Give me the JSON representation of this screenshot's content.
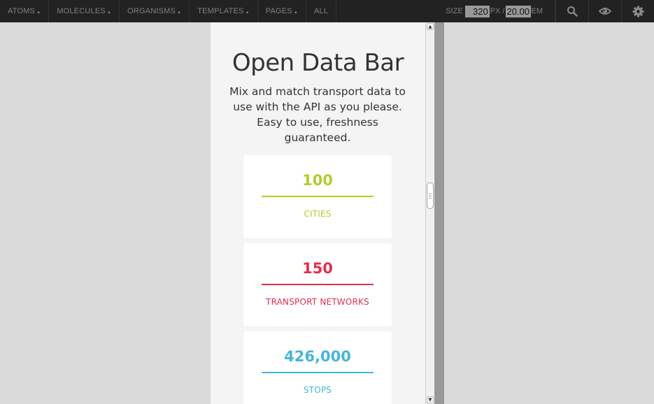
{
  "nav": {
    "items": [
      {
        "label": "ATOMS",
        "caret": "▲",
        "name": "nav-atoms"
      },
      {
        "label": "MOLECULES",
        "caret": "▲",
        "name": "nav-molecules"
      },
      {
        "label": "ORGANISMS",
        "caret": "▲",
        "name": "nav-organisms"
      },
      {
        "label": "TEMPLATES",
        "caret": "▲",
        "name": "nav-templates"
      },
      {
        "label": "PAGES",
        "caret": "▲",
        "name": "nav-pages"
      },
      {
        "label": "ALL",
        "caret": "",
        "name": "nav-all"
      }
    ],
    "size": {
      "label": "SIZE",
      "px_value": "320",
      "px_unit": "PX /",
      "em_value": "20.00",
      "em_unit": "EM"
    },
    "icons": [
      "search-icon",
      "eye-icon",
      "gear-icon"
    ]
  },
  "hero": {
    "title": "Open Data Bar",
    "description": "Mix and match transport data to use with the API as you please. Easy to use, freshness guaranteed."
  },
  "stats": [
    {
      "value": "100",
      "label": "CITIES",
      "color": "#b5cc2e"
    },
    {
      "value": "150",
      "label": "TRANSPORT NETWORKS",
      "color": "#e0304e"
    },
    {
      "value": "426,000",
      "label": "STOPS",
      "color": "#48b5d9"
    }
  ],
  "scrollbar": {
    "up_arrow": "▲",
    "down_arrow": "▼",
    "position_fraction": 0.43
  },
  "colors": {
    "toolbar": "#222222",
    "viewport_bg": "#f4f4f4",
    "page_bg": "#dadada",
    "handle": "#999999"
  }
}
